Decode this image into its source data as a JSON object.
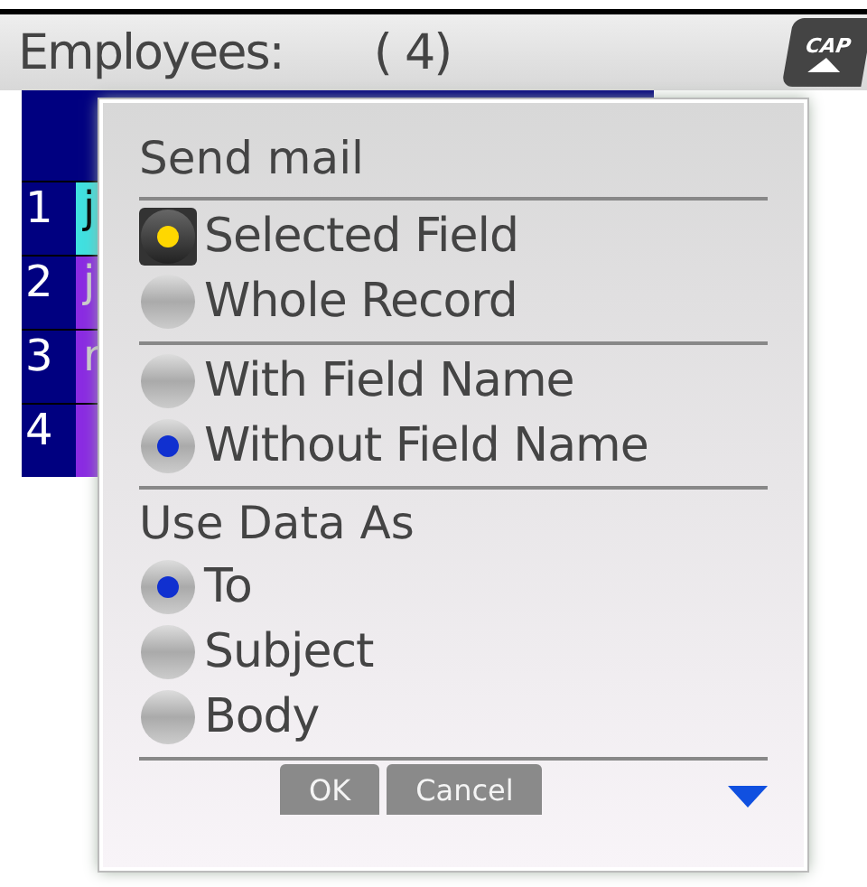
{
  "header": {
    "title": "Employees:",
    "count": "( 4)",
    "cap_label": "CAP"
  },
  "table": {
    "rows": [
      {
        "number": "1",
        "cell": "j",
        "selected": true
      },
      {
        "number": "2",
        "cell": "j",
        "selected": false
      },
      {
        "number": "3",
        "cell": "r",
        "selected": false
      },
      {
        "number": "4",
        "selected": false
      }
    ]
  },
  "dialog": {
    "title": "Send mail",
    "sections": [
      {
        "options": [
          {
            "label": "Selected Field",
            "selected": true,
            "focused": true
          },
          {
            "label": "Whole Record",
            "selected": false,
            "focused": false
          }
        ]
      },
      {
        "options": [
          {
            "label": "With Field Name",
            "selected": false,
            "focused": false
          },
          {
            "label": "Without Field Name",
            "selected": true,
            "focused": false
          }
        ]
      },
      {
        "heading": "Use Data As",
        "options": [
          {
            "label": "To",
            "selected": true,
            "focused": false
          },
          {
            "label": "Subject",
            "selected": false,
            "focused": false
          },
          {
            "label": "Body",
            "selected": false,
            "focused": false
          }
        ]
      }
    ],
    "buttons": [
      {
        "label": "OK",
        "disabled": true
      },
      {
        "label": "Cancel",
        "disabled": true
      }
    ],
    "more_below": true
  }
}
